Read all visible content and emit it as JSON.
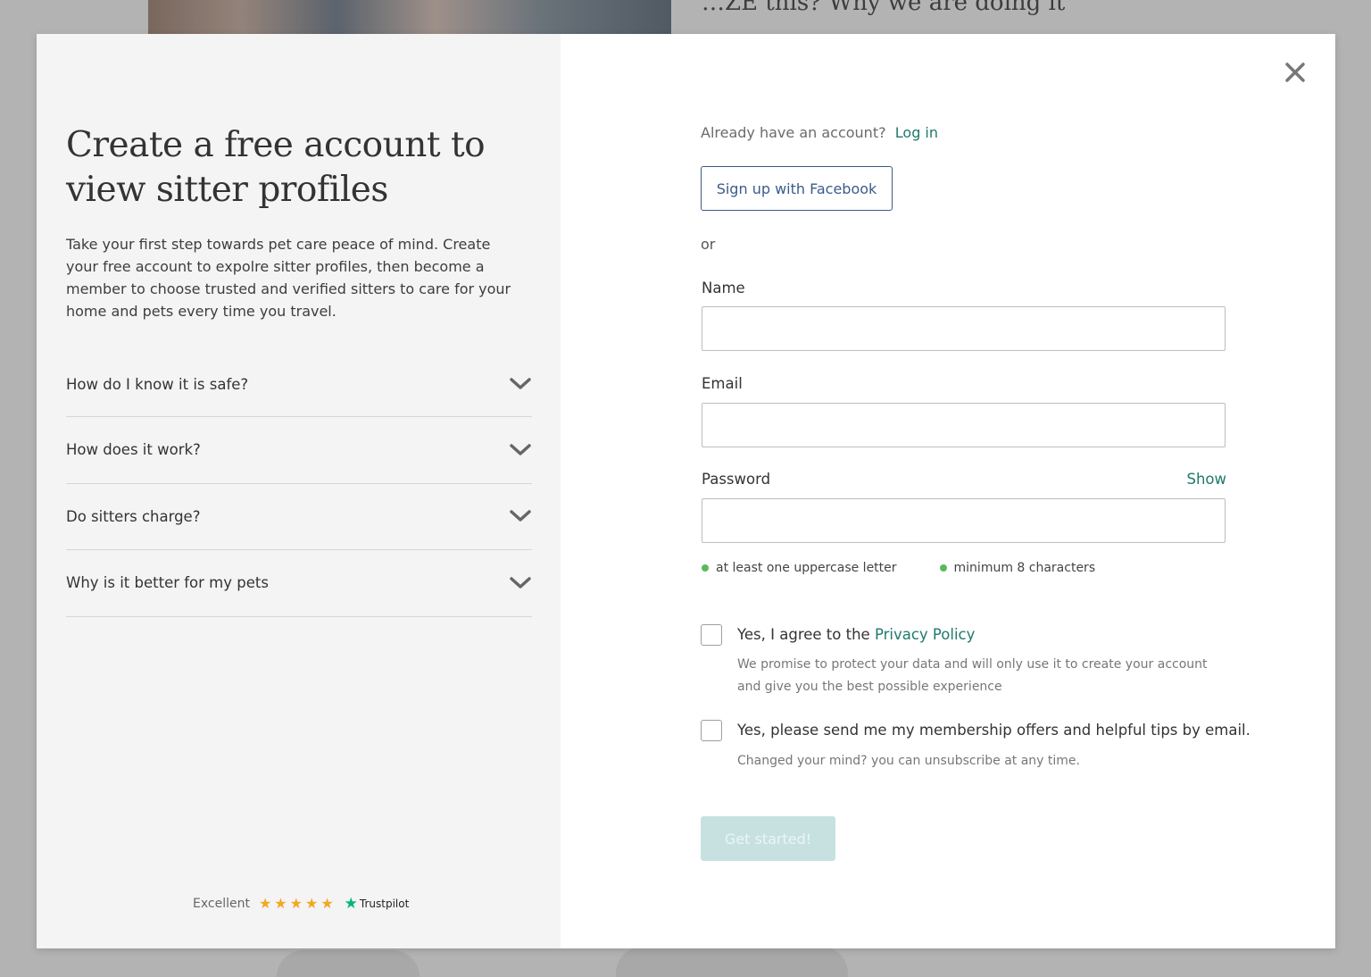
{
  "background": {
    "heading": "…ZE this? Why we are doing it"
  },
  "left": {
    "headline": "Create a free account to view sitter profiles",
    "intro": "Take your first step towards pet care peace of mind. Create your free account to expolre sitter profiles, then become a member to choose trusted and verified sitters to care for your home and pets every time you travel.",
    "faq": [
      {
        "label": "How do I know it is safe?"
      },
      {
        "label": "How does it work?"
      },
      {
        "label": "Do sitters charge?"
      },
      {
        "label": "Why is it better for my pets"
      }
    ],
    "trust": {
      "rating_text": "Excellent",
      "stars": 5,
      "brand": "Trustpilot"
    }
  },
  "right": {
    "already_text": "Already have an account?",
    "login_link": "Log in",
    "facebook_button": "Sign up with Facebook",
    "or_text": "or",
    "name_label": "Name",
    "email_label": "Email",
    "password_label": "Password",
    "show_link": "Show",
    "password_rules": [
      "at least one uppercase letter",
      "minimum 8 characters"
    ],
    "privacy": {
      "text": "Yes, I agree to the",
      "link": "Privacy Policy",
      "subtext": "We promise to protect your data and will only use it to create your account and give you the best possible experience"
    },
    "marketing": {
      "text": "Yes, please send me my membership offers and helpful tips by email.",
      "subtext": "Changed your mind? you can unsubscribe at any time."
    },
    "submit_button": "Get started!"
  },
  "colors": {
    "accent": "#1f7a6b",
    "facebook": "#3b5b8a",
    "rule_dot": "#5cb85c",
    "star": "#f5a623",
    "trustpilot_green": "#00b67a",
    "submit_disabled": "#c7e1e0"
  }
}
